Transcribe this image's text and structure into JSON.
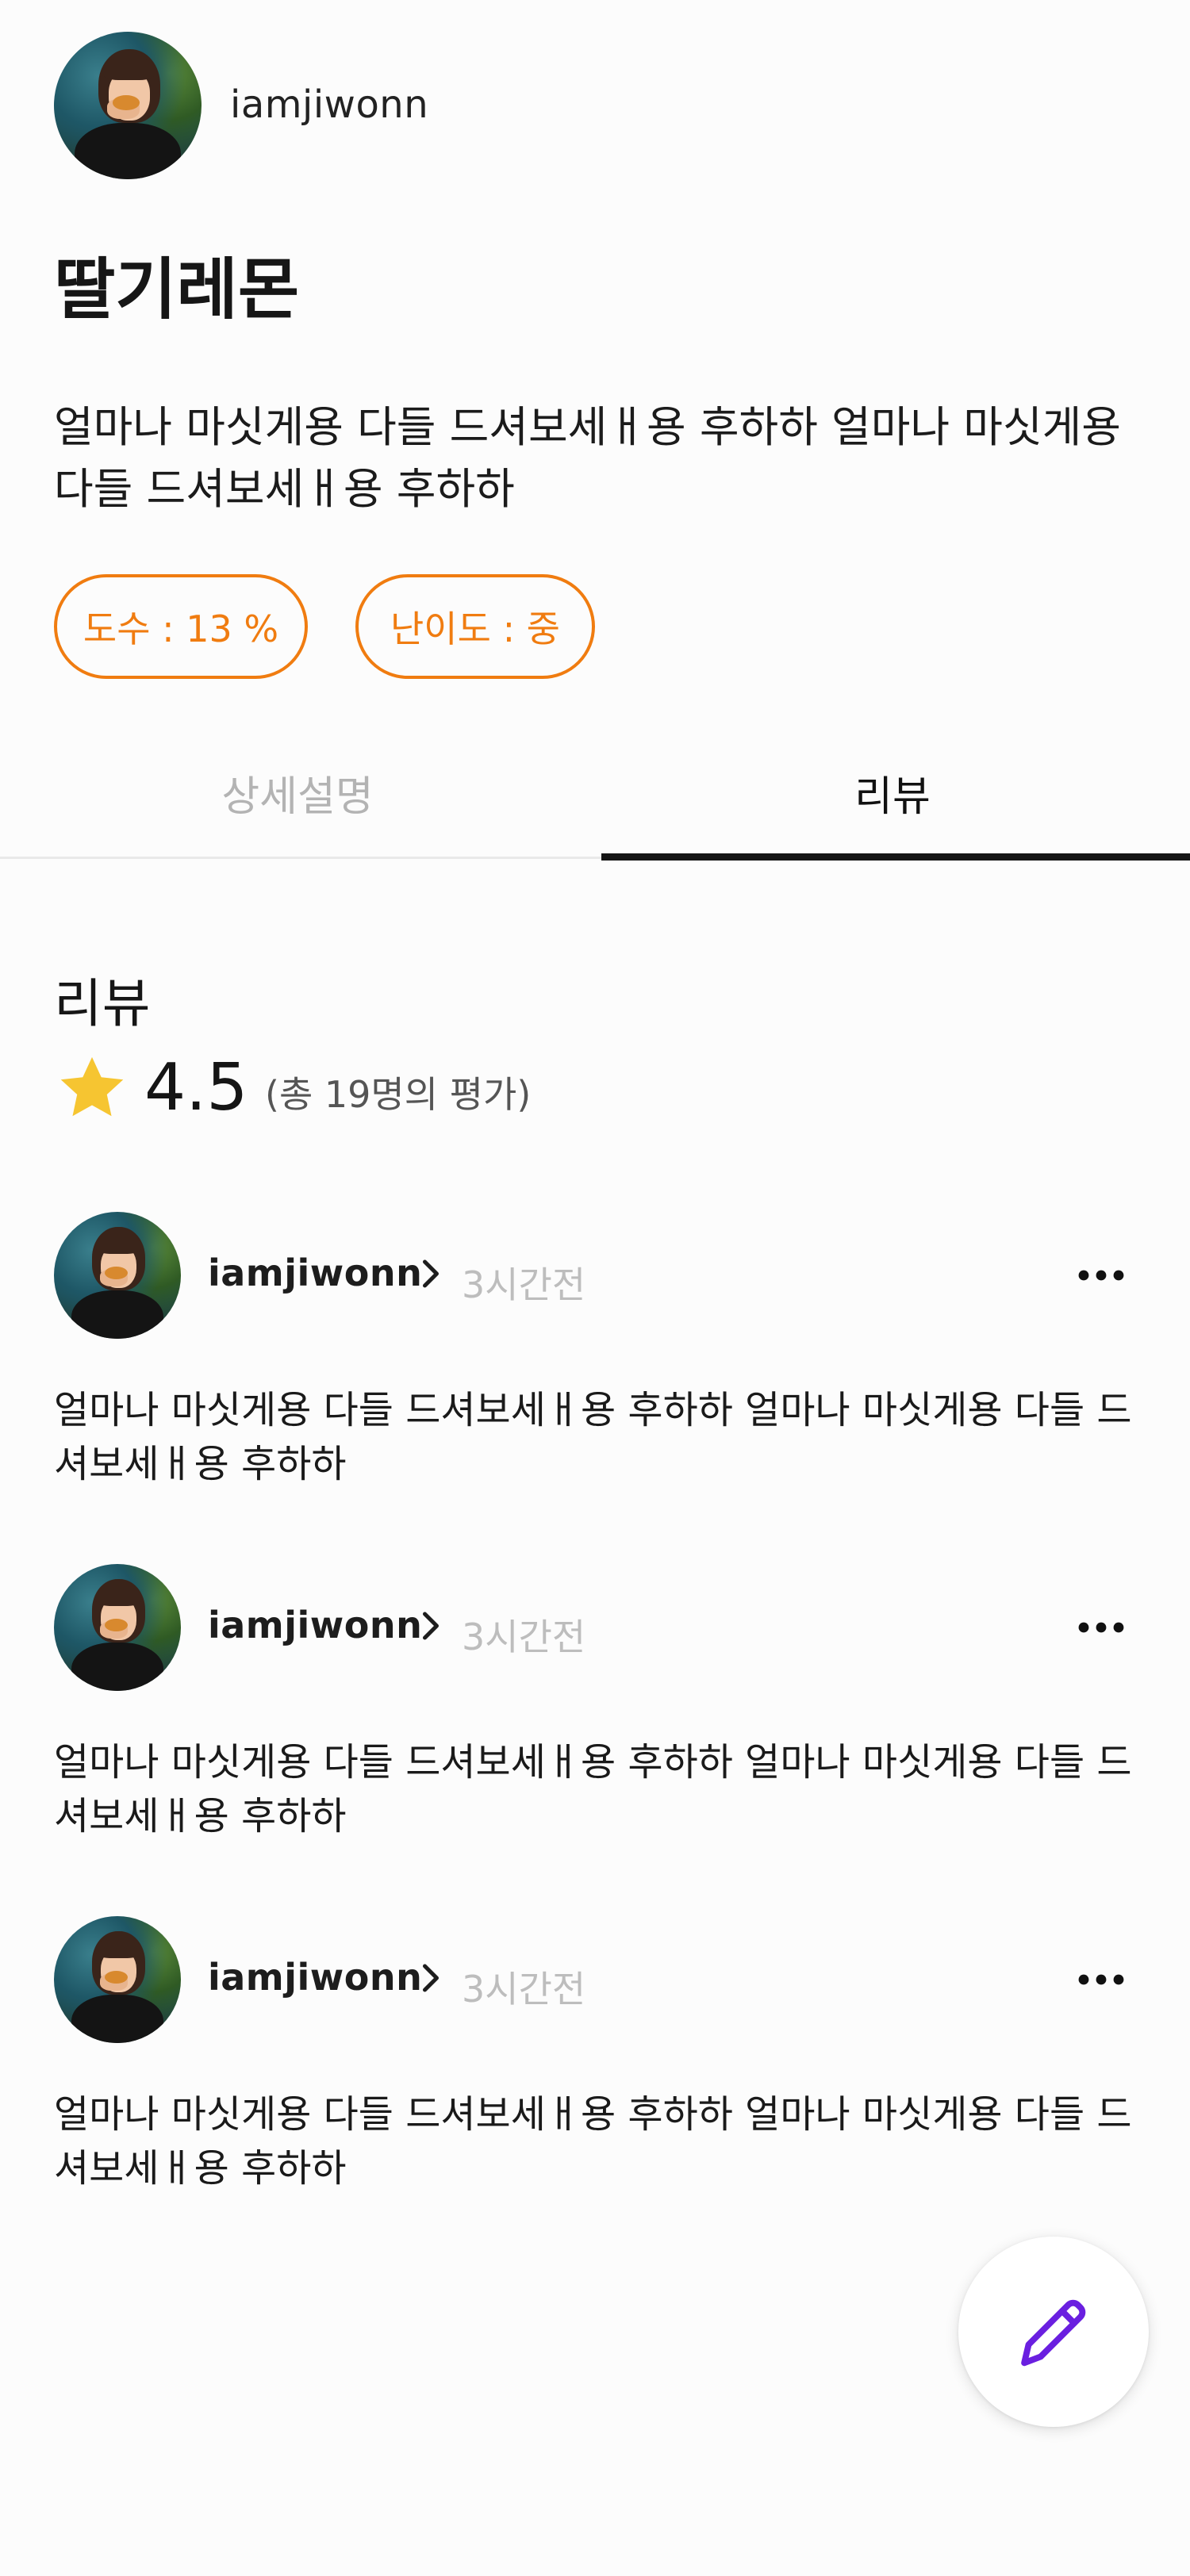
{
  "owner": {
    "username": "iamjiwonn"
  },
  "drink": {
    "title": "딸기레몬",
    "description": "얼마나 마싯게용 다들 드셔보세ㅐ용 후하하 얼마나 마싯게용 다들 드셔보세ㅐ용 후하하",
    "tags": {
      "abv": "도수 : 13 %",
      "difficulty": "난이도 : 중"
    }
  },
  "tabs": {
    "detail": "상세설명",
    "review": "리뷰",
    "active": "리뷰"
  },
  "reviews_section": {
    "title": "리뷰",
    "rating": "4.5",
    "rating_count": "(총 19명의 평가)"
  },
  "reviews": [
    {
      "username": "iamjiwonn",
      "time": "3시간전",
      "text": "얼마나 마싯게용 다들 드셔보세ㅐ용 후하하 얼마나 마싯게용 다들 드셔보세ㅐ용 후하하"
    },
    {
      "username": "iamjiwonn",
      "time": "3시간전",
      "text": "얼마나 마싯게용 다들 드셔보세ㅐ용 후하하 얼마나 마싯게용 다들 드셔보세ㅐ용 후하하"
    },
    {
      "username": "iamjiwonn",
      "time": "3시간전",
      "text": "얼마나 마싯게용 다들 드셔보세ㅐ용 후하하 얼마나 마싯게용 다들 드셔보세ㅐ용 후하하"
    }
  ],
  "icons": {
    "star": "star-icon",
    "chevron": "chevron-right-icon",
    "more": "more-horizontal-icon",
    "write": "pencil-icon"
  },
  "colors": {
    "accent": "#f07c10",
    "star": "#f6c531",
    "fab_icon": "#6a1fe0",
    "muted_text": "#b3b3b3"
  }
}
